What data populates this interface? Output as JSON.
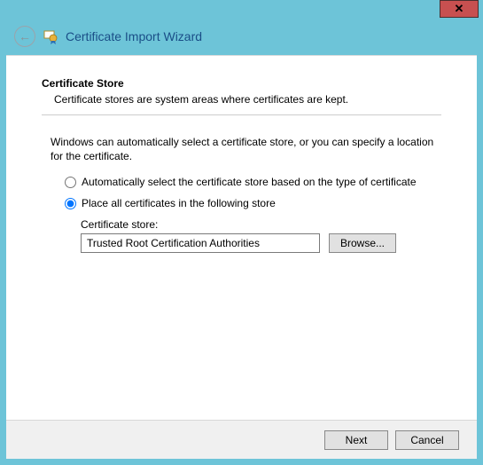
{
  "window": {
    "title": "Certificate Import Wizard",
    "close_glyph": "✕"
  },
  "section": {
    "heading": "Certificate Store",
    "description": "Certificate stores are system areas where certificates are kept."
  },
  "instruction": "Windows can automatically select a certificate store, or you can specify a location for the certificate.",
  "options": {
    "auto": "Automatically select the certificate store based on the type of certificate",
    "place": "Place all certificates in the following store",
    "selected": "place"
  },
  "store": {
    "label": "Certificate store:",
    "value": "Trusted Root Certification Authorities",
    "browse": "Browse..."
  },
  "buttons": {
    "next": "Next",
    "cancel": "Cancel"
  }
}
